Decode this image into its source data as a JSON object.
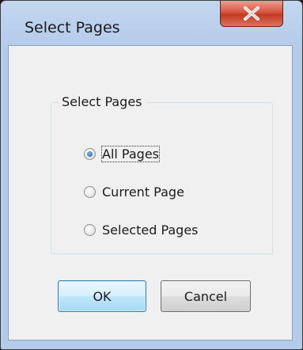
{
  "dialog": {
    "title": "Select Pages"
  },
  "group": {
    "legend": "Select Pages",
    "options": [
      {
        "label": "All Pages",
        "checked": true
      },
      {
        "label": "Current Page",
        "checked": false
      },
      {
        "label": "Selected Pages",
        "checked": false
      }
    ]
  },
  "buttons": {
    "ok": "OK",
    "cancel": "Cancel"
  },
  "icons": {
    "close": "close-icon"
  },
  "colors": {
    "close_button": "#c23a22",
    "frame": "#b4cbea",
    "client": "#f0f0f0"
  }
}
